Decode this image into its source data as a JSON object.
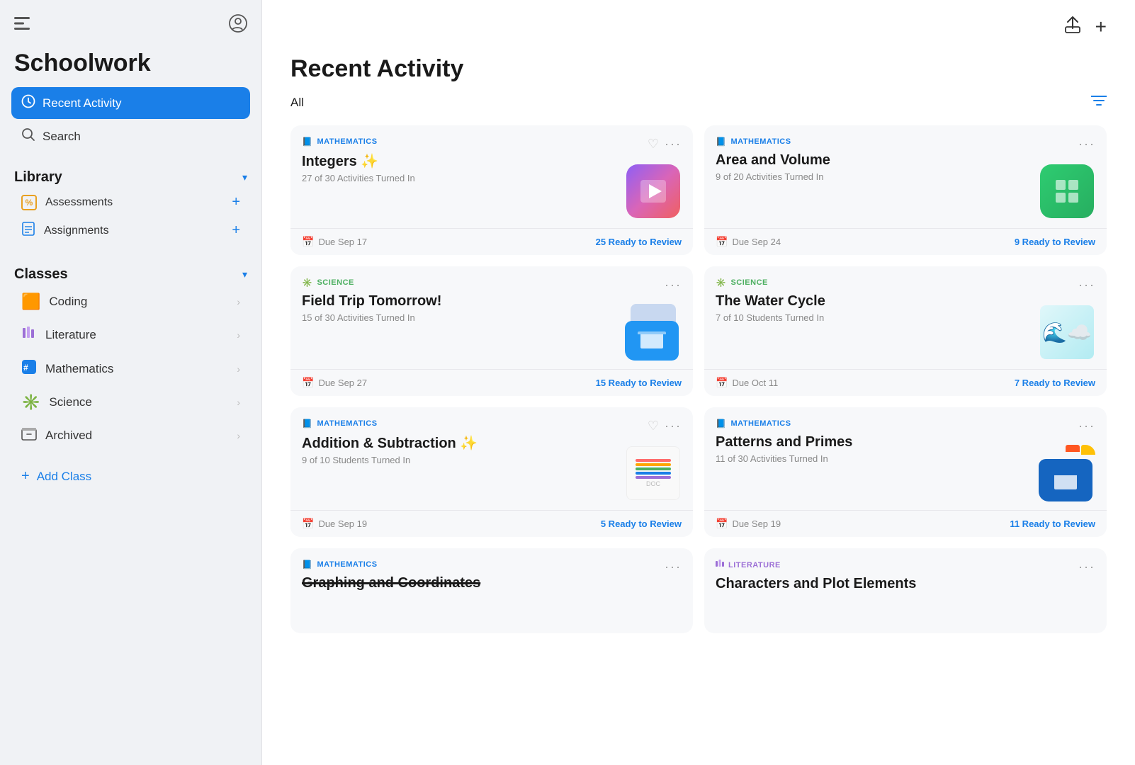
{
  "sidebar": {
    "title": "Schoolwork",
    "top_icons": {
      "sidebar_toggle": "⊟",
      "profile": "👤"
    },
    "nav": {
      "recent_activity": {
        "label": "Recent Activity",
        "icon": "🕐",
        "active": true
      },
      "search": {
        "label": "Search",
        "icon": "🔍"
      }
    },
    "library": {
      "header": "Library",
      "items": [
        {
          "label": "Assessments",
          "icon": "%"
        },
        {
          "label": "Assignments",
          "icon": "📋"
        }
      ]
    },
    "classes": {
      "header": "Classes",
      "items": [
        {
          "label": "Coding",
          "icon": "🟧"
        },
        {
          "label": "Literature",
          "icon": "📊"
        },
        {
          "label": "Mathematics",
          "icon": "🔢"
        },
        {
          "label": "Science",
          "icon": "🔬"
        },
        {
          "label": "Archived",
          "icon": "🗂"
        }
      ]
    },
    "add_class": "Add Class"
  },
  "main": {
    "header_btn_share": "↑",
    "header_btn_add": "+",
    "page_title": "Recent Activity",
    "filter_label": "All",
    "cards": [
      {
        "subject": "MATHEMATICS",
        "subject_type": "math",
        "title": "Integers ✨",
        "subtitle": "27 of 30 Activities Turned In",
        "thumbnail_type": "keynote",
        "due_date": "Due Sep 17",
        "ready_review": "25 Ready to Review",
        "has_heart": true
      },
      {
        "subject": "MATHEMATICS",
        "subject_type": "math",
        "title": "Area and Volume",
        "subtitle": "9 of 20 Activities Turned In",
        "thumbnail_type": "numbers",
        "due_date": "Due Sep 24",
        "ready_review": "9 Ready to Review",
        "has_heart": false
      },
      {
        "subject": "SCIENCE",
        "subject_type": "science",
        "title": "Field Trip Tomorrow!",
        "subtitle": "15 of 30 Activities Turned In",
        "thumbnail_type": "folder",
        "due_date": "Due Sep 27",
        "ready_review": "15 Ready to Review",
        "has_heart": false
      },
      {
        "subject": "SCIENCE",
        "subject_type": "science",
        "title": "The Water Cycle",
        "subtitle": "7 of 10 Students Turned In",
        "thumbnail_type": "water",
        "due_date": "Due Oct 11",
        "ready_review": "7 Ready to Review",
        "has_heart": false
      },
      {
        "subject": "MATHEMATICS",
        "subject_type": "math",
        "title": "Addition & Subtraction ✨",
        "subtitle": "9 of 10 Students Turned In",
        "thumbnail_type": "mathdoc",
        "due_date": "Due Sep 19",
        "ready_review": "5 Ready to Review",
        "has_heart": true
      },
      {
        "subject": "MATHEMATICS",
        "subject_type": "math",
        "title": "Patterns and Primes",
        "subtitle": "11 of 30 Activities Turned In",
        "thumbnail_type": "folder2",
        "due_date": "Due Sep 19",
        "ready_review": "11 Ready to Review",
        "has_heart": false
      },
      {
        "subject": "MATHEMATICS",
        "subject_type": "math",
        "title": "Graphing and Coordinates",
        "subtitle": "",
        "thumbnail_type": "bar",
        "due_date": "",
        "ready_review": "",
        "has_heart": false,
        "partial": true
      },
      {
        "subject": "LITERATURE",
        "subject_type": "literature",
        "title": "Characters and Plot Elements",
        "subtitle": "",
        "thumbnail_type": "none",
        "due_date": "",
        "ready_review": "",
        "has_heart": false,
        "partial": true
      }
    ]
  }
}
